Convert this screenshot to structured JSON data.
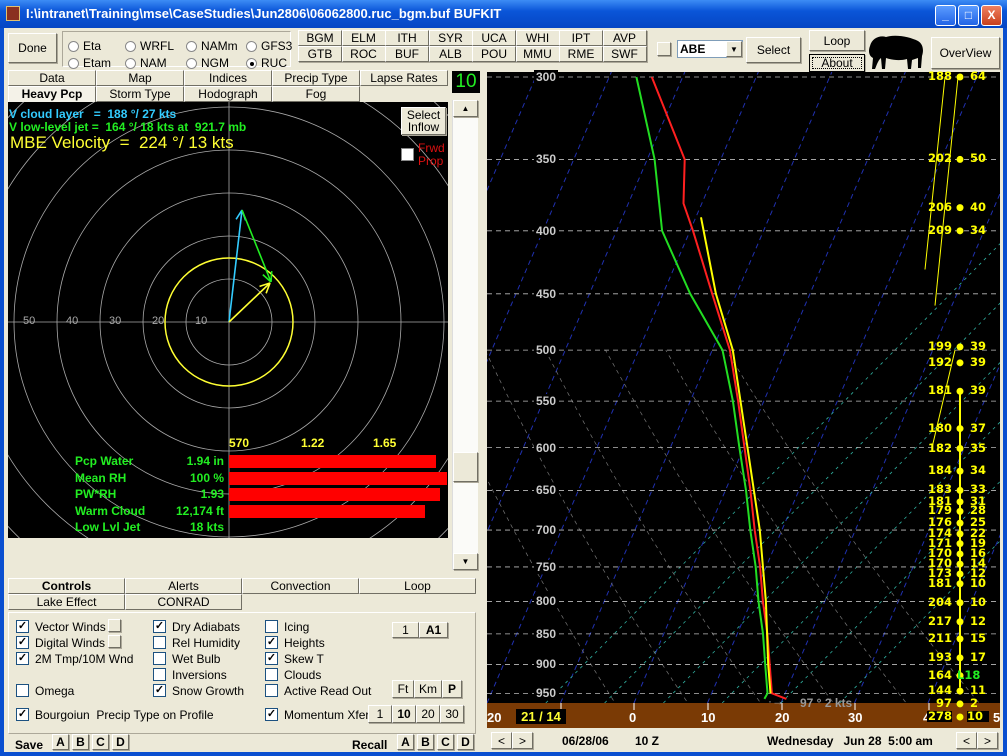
{
  "window": {
    "title": "I:\\intranet\\Training\\mse\\CaseStudies\\Jun2806\\06062800.ruc_bgm.buf BUFKIT",
    "minimize": "_",
    "maximize": "□",
    "close": "X"
  },
  "toolbar": {
    "done": "Done",
    "models": [
      {
        "label": "Eta",
        "selected": false
      },
      {
        "label": "WRFL",
        "selected": false
      },
      {
        "label": "NAMm",
        "selected": false
      },
      {
        "label": "GFS3",
        "selected": false
      },
      {
        "label": "Etam",
        "selected": false
      },
      {
        "label": "NAM",
        "selected": false
      },
      {
        "label": "NGM",
        "selected": false
      },
      {
        "label": "RUC",
        "selected": true
      }
    ],
    "stations": [
      "BGM",
      "ELM",
      "ITH",
      "SYR",
      "UCA",
      "WHI",
      "IPT",
      "AVP",
      "GTB",
      "ROC",
      "BUF",
      "ALB",
      "POU",
      "MMU",
      "RME",
      "SWF"
    ],
    "station_combo": "ABE",
    "select": "Select",
    "loop": "Loop",
    "about": "About",
    "overview": "OverView"
  },
  "left_tabs": {
    "row1": [
      "Data",
      "Map",
      "Indices",
      "Precip Type",
      "Lapse Rates"
    ],
    "row2": [
      "Heavy Pcp",
      "Storm Type",
      "Hodograph",
      "Fog"
    ],
    "selected": "Heavy Pcp",
    "counter": "10"
  },
  "heavy_pcp": {
    "cloud_layer": "V cloud layer   =  188 °/ 27 kts",
    "low_level_jet": "V low-level jet =  164 °/ 18 kts at  921.7 mb",
    "mbe_velocity": "MBE Velocity  =  224 °/ 13 kts",
    "select_inflow": "Select Inflow",
    "frwd_prop": "Frwd Prop",
    "frwd_prop_checked": false,
    "ring_labels": [
      "50",
      "40",
      "30",
      "20",
      "10"
    ],
    "bar_scale": [
      "570",
      "1.22",
      "1.65"
    ],
    "rows": [
      {
        "label": "Pcp Water",
        "value": "1.94 in",
        "fill": 0.95
      },
      {
        "label": "Mean RH",
        "value": "100 %",
        "fill": 1.0
      },
      {
        "label": "PW*RH",
        "value": "1.93",
        "fill": 0.97
      },
      {
        "label": "Warm Cloud",
        "value": "12,174 ft",
        "fill": 0.9
      },
      {
        "label": "Low Lvl Jet",
        "value": "18 kts",
        "fill": 0
      }
    ],
    "colors": {
      "cloud_layer": "#33ccff",
      "llj": "#22ee22",
      "mbe": "#ffff33",
      "bars": "#ff0000"
    }
  },
  "bottom_tabs": {
    "row1": [
      "Controls",
      "Alerts",
      "Convection",
      "Loop"
    ],
    "row2": [
      "Lake Effect",
      "CONRAD"
    ],
    "selected": "Controls"
  },
  "controls": {
    "vector_winds": {
      "label": "Vector Winds",
      "checked": true
    },
    "digital_winds": {
      "label": "Digital Winds",
      "checked": true
    },
    "tmp_wnd": {
      "label": "2M Tmp/10M Wnd",
      "checked": true
    },
    "omega": {
      "label": "Omega",
      "checked": false
    },
    "bourgoiun": {
      "label": "Bourgoiun  Precip Type on Profile",
      "checked": true
    },
    "dry_adiabats": {
      "label": "Dry Adiabats",
      "checked": true
    },
    "rel_humidity": {
      "label": "Rel Humidity",
      "checked": false
    },
    "wet_bulb": {
      "label": "Wet Bulb",
      "checked": false
    },
    "inversions": {
      "label": "Inversions",
      "checked": false
    },
    "snow_growth": {
      "label": "Snow Growth",
      "checked": true
    },
    "icing": {
      "label": "Icing",
      "checked": false
    },
    "heights": {
      "label": "Heights",
      "checked": true
    },
    "skew_t": {
      "label": "Skew T",
      "checked": true
    },
    "clouds": {
      "label": "Clouds",
      "checked": false
    },
    "active_read_out": {
      "label": "Active Read Out",
      "checked": false
    },
    "momentum_xfer": {
      "label": "Momentum Xfer",
      "checked": true
    },
    "btn_1": "1",
    "btn_a1": "A1",
    "units": [
      "Ft",
      "Km",
      "P"
    ],
    "momentum": [
      "1",
      "10",
      "20",
      "30"
    ],
    "save": "Save",
    "recall": "Recall",
    "slots": [
      "A",
      "B",
      "C",
      "D"
    ]
  },
  "skewt": {
    "pressure_labels": [
      300,
      350,
      400,
      450,
      500,
      550,
      600,
      650,
      700,
      750,
      800,
      850,
      900,
      950
    ],
    "temp_labels": [
      "20",
      "0",
      "10",
      "20",
      "30",
      "4",
      "5"
    ],
    "sfc_box": "21 / 14",
    "sfc_wind_box": {
      "dir": "278",
      "speed": "10"
    },
    "sfc_wind_text": "97 ° 2 kts",
    "temperature": [
      [
        960,
        20.5
      ],
      [
        950,
        18.2
      ],
      [
        900,
        16.2
      ],
      [
        850,
        14.1
      ],
      [
        800,
        11.6
      ],
      [
        750,
        9.2
      ],
      [
        700,
        6.3
      ],
      [
        650,
        3.4
      ],
      [
        600,
        0.1
      ],
      [
        550,
        -3.5
      ],
      [
        500,
        -7.6
      ],
      [
        450,
        -13.3
      ],
      [
        400,
        -19.6
      ],
      [
        380,
        -22.5
      ],
      [
        350,
        -24.9
      ],
      [
        300,
        -34.2
      ]
    ],
    "dewpoint": [
      [
        960,
        17.5
      ],
      [
        950,
        17.6
      ],
      [
        900,
        15.6
      ],
      [
        850,
        13.5
      ],
      [
        800,
        11.0
      ],
      [
        750,
        8.6
      ],
      [
        700,
        5.7
      ],
      [
        650,
        2.8
      ],
      [
        600,
        -0.6
      ],
      [
        550,
        -4.2
      ],
      [
        500,
        -8.6
      ],
      [
        450,
        -16.3
      ],
      [
        400,
        -23.8
      ],
      [
        350,
        -29.0
      ],
      [
        300,
        -36.3
      ]
    ],
    "parcel": [
      [
        950,
        18.0
      ],
      [
        900,
        16.0
      ],
      [
        800,
        12.0
      ],
      [
        700,
        7.0
      ],
      [
        600,
        0.5
      ],
      [
        500,
        -7.2
      ],
      [
        450,
        -12.8
      ],
      [
        390,
        -19.3
      ]
    ],
    "winds": [
      {
        "p": 300,
        "dir": "188",
        "spd": "64"
      },
      {
        "p": 350,
        "dir": "202",
        "spd": "50"
      },
      {
        "p": 383,
        "dir": "206",
        "spd": "40"
      },
      {
        "p": 400,
        "dir": "209",
        "spd": "34"
      },
      {
        "p": 497,
        "dir": "199",
        "spd": "39"
      },
      {
        "p": 512,
        "dir": "192",
        "spd": "39"
      },
      {
        "p": 540,
        "dir": "181",
        "spd": "39"
      },
      {
        "p": 579,
        "dir": "180",
        "spd": "37"
      },
      {
        "p": 601,
        "dir": "182",
        "spd": "35"
      },
      {
        "p": 627,
        "dir": "184",
        "spd": "34"
      },
      {
        "p": 650,
        "dir": "183",
        "spd": "33"
      },
      {
        "p": 664,
        "dir": "181",
        "spd": "31"
      },
      {
        "p": 676,
        "dir": "179",
        "spd": "28"
      },
      {
        "p": 691,
        "dir": "176",
        "spd": "25"
      },
      {
        "p": 705,
        "dir": "174",
        "spd": "22"
      },
      {
        "p": 718,
        "dir": "171",
        "spd": "19"
      },
      {
        "p": 732,
        "dir": "170",
        "spd": "16"
      },
      {
        "p": 746,
        "dir": "170",
        "spd": "14"
      },
      {
        "p": 760,
        "dir": "173",
        "spd": "12"
      },
      {
        "p": 774,
        "dir": "181",
        "spd": "10"
      },
      {
        "p": 802,
        "dir": "204",
        "spd": "10"
      },
      {
        "p": 831,
        "dir": "217",
        "spd": "12"
      },
      {
        "p": 858,
        "dir": "211",
        "spd": "15"
      },
      {
        "p": 889,
        "dir": "193",
        "spd": "17"
      },
      {
        "p": 919,
        "dir": "164",
        "spd": "L18",
        "llj": true
      },
      {
        "p": 946,
        "dir": "144",
        "spd": "11"
      },
      {
        "p": 969,
        "dir": "97",
        "spd": "2"
      }
    ],
    "colors": {
      "temperature": "#ff2020",
      "dewpoint": "#22dd22",
      "parcel": "#ffff00",
      "isotherm": "#2030b0",
      "mixing": "#30b0a0",
      "sfc_strip": "#7a3a05"
    }
  },
  "status": {
    "date": "06/28/06",
    "hour": "10 Z",
    "valid": "Wednesday   Jun 28  5:00 am",
    "prev": "<",
    "next": ">"
  }
}
